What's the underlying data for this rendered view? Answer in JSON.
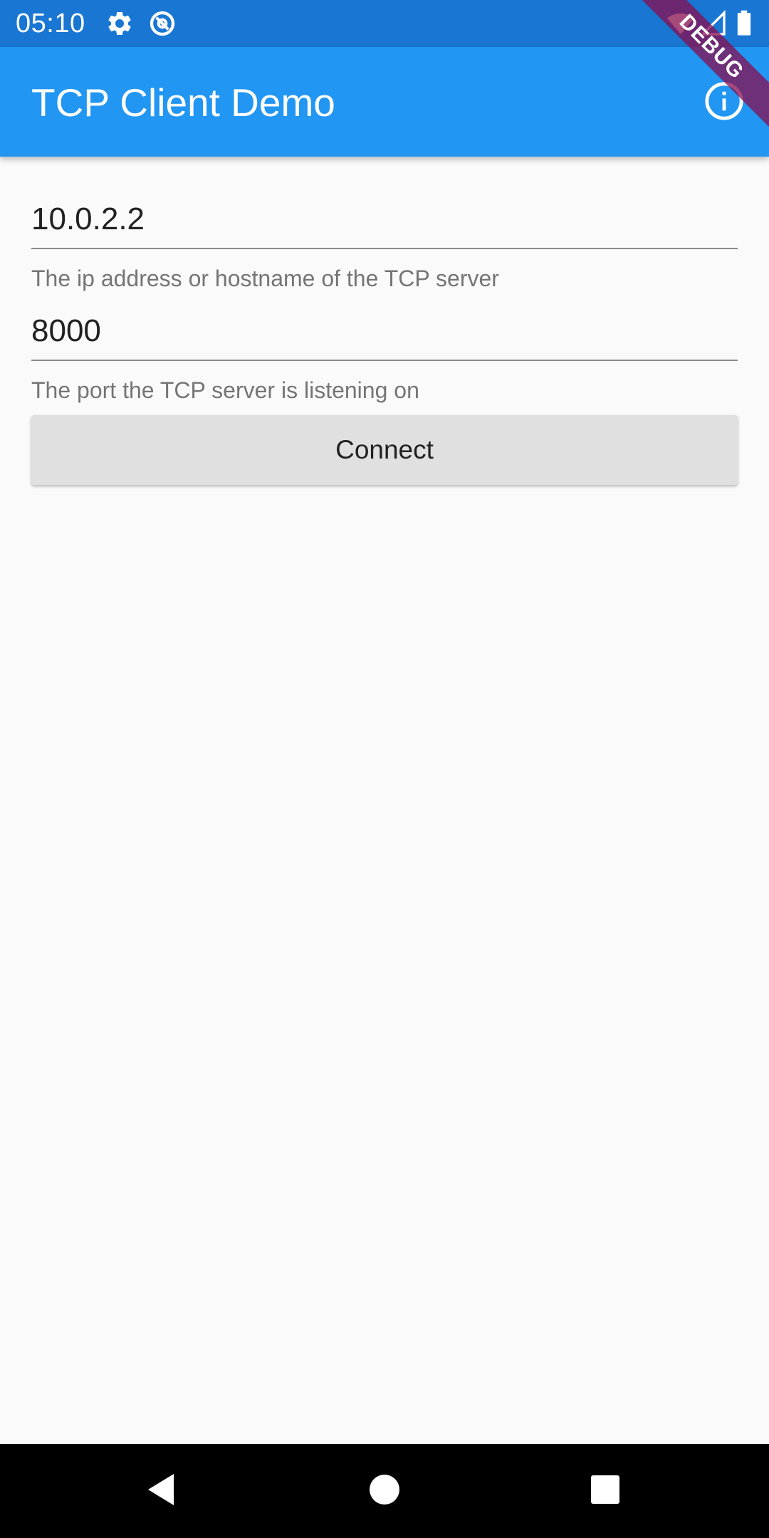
{
  "status_bar": {
    "time": "05:10",
    "icons": [
      "gear-icon",
      "at-sign-icon",
      "wifi-icon",
      "signal-icon",
      "battery-icon"
    ]
  },
  "app_bar": {
    "title": "TCP Client Demo",
    "action_icon": "info-icon"
  },
  "debug_banner": {
    "label": "DEBUG"
  },
  "form": {
    "host": {
      "value": "10.0.2.2",
      "helper": "The ip address or hostname of the TCP server"
    },
    "port": {
      "value": "8000",
      "helper": "The port the TCP server is listening on"
    },
    "connect_label": "Connect"
  },
  "nav_bar": {
    "icons": [
      "back-icon",
      "home-icon",
      "recents-icon"
    ]
  },
  "colors": {
    "status_bar": "#1976d2",
    "app_bar": "#2196f3",
    "background": "#fafafa",
    "button": "#e0e0e0",
    "debug_ribbon": "#880e4f"
  }
}
